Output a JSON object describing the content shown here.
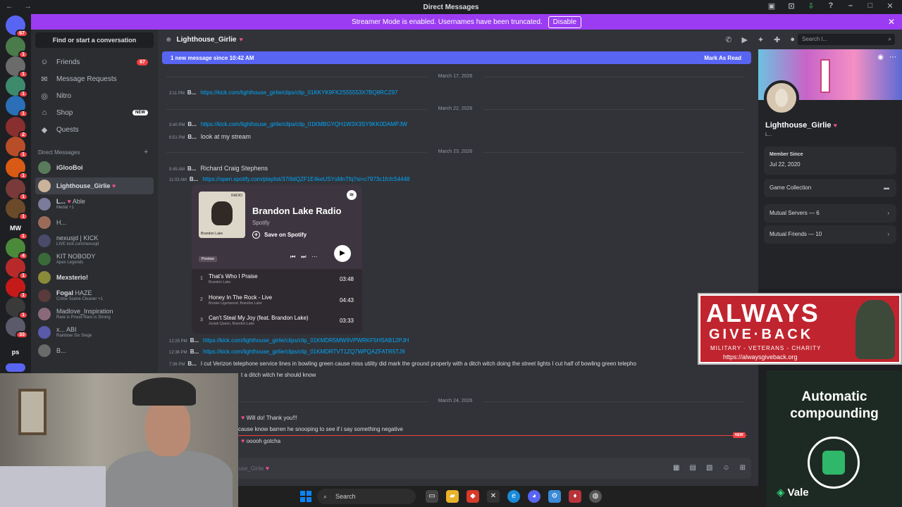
{
  "window": {
    "title": "Direct Messages"
  },
  "banner": {
    "text": "Streamer Mode is enabled. Usernames have been truncated.",
    "button": "Disable"
  },
  "servers": [
    {
      "badge": "67"
    },
    {
      "badge": "1"
    },
    {
      "badge": "1"
    },
    {
      "badge": "1"
    },
    {
      "badge": "1"
    },
    {
      "badge": "2"
    },
    {
      "badge": "1"
    },
    {
      "badge": "1"
    },
    {
      "badge": "1"
    },
    {
      "badge": "1"
    },
    {
      "badge": "1"
    },
    {
      "badge": "4"
    },
    {
      "badge": "1"
    },
    {
      "badge": "1"
    },
    {
      "badge": "1"
    },
    {
      "badge": "1"
    },
    {
      "badge": "33"
    },
    {
      "badge": "2"
    }
  ],
  "server_labels": {
    "mw": "MW",
    "ps": "ps"
  },
  "sidebar": {
    "search": "Find or start a conversation",
    "nav": [
      {
        "label": "Friends",
        "badge": "67"
      },
      {
        "label": "Message Requests"
      },
      {
        "label": "Nitro"
      },
      {
        "label": "Shop",
        "badge": "NEW"
      },
      {
        "label": "Quests"
      }
    ],
    "dm_header": "Direct Messages",
    "dms": [
      {
        "name": "iGlooBoi",
        "sub": ""
      },
      {
        "name": "Lighthouse_Girlie",
        "sub": ""
      },
      {
        "name": "L...",
        "sub": "Medal +1",
        "tag": "Able"
      },
      {
        "name": "H...",
        "sub": ""
      },
      {
        "name": "nexusjd | KICK",
        "sub": "LIVE kick.com/nexusjd"
      },
      {
        "name": "KIT NOBODY",
        "sub": "Apex Legends"
      },
      {
        "name": "Mexsterio!",
        "sub": ""
      },
      {
        "name": "Fogal",
        "sub": "Crime Scene Cleaner +1",
        "tag": "HAZE"
      },
      {
        "name": "Madlove_Inspiration",
        "sub": "Rare is Proud Rare is Strong"
      },
      {
        "name": "x...",
        "sub": "Rainbow Six Siege",
        "tag": "ABI"
      },
      {
        "name": "B...",
        "sub": ""
      }
    ]
  },
  "chat": {
    "channel": "Lighthouse_Girlie",
    "search_placeholder": "Search l...",
    "new_bar": "1 new message since 10:42 AM",
    "mark_read": "Mark As Read",
    "dates": [
      "March 17, 2026",
      "March 22, 2026",
      "March 23, 2026",
      "March 24, 2026"
    ],
    "messages": [
      {
        "time": "3:11 PM",
        "author": "B...",
        "text": "https://kick.com/lighthouse_girlie/clips/clip_01KKYK9FK2S55553X7BQ8RCZ97",
        "link": true
      },
      {
        "time": "3:40 PM",
        "author": "B...",
        "text": "https://kick.com/lighthouse_girlie/clips/clip_01KMBGYQH1W3X3SY9KK0DAMPJW",
        "link": true
      },
      {
        "time": "6:51 PM",
        "author": "B...",
        "text": "look at my stream",
        "link": false
      },
      {
        "time": "9:45 AM",
        "author": "B...",
        "text": "Richard Craig Stephens",
        "link": false
      },
      {
        "time": "11:03 AM",
        "author": "B...",
        "text": "https://open.spotify.com/playlist/37i9dQZF1E4keUSYsMnTfq?si=c7973c1fcfc54448",
        "link": true
      },
      {
        "time": "12:25 PM",
        "author": "B...",
        "text": "https://kick.com/lighthouse_girlie/clips/clip_01KMDR5MW9VPWRKF5HSAB12PJH",
        "link": true
      },
      {
        "time": "12:36 PM",
        "author": "B...",
        "text": "https://kick.com/lighthouse_girlie/clips/clip_01KMDRTVT1ZQ7WPQAZFATR5TJ9",
        "link": true
      },
      {
        "time": "7:36 PM",
        "author": "B...",
        "text": "I cut Verizon telephone service lines in bowling green cause miss utility did mark the ground properly with a ditch witch doing the street lights I cut half of bowling green telepho",
        "link": false
      },
      {
        "time": "",
        "author": "",
        "text": "t a ditch witch he should know",
        "link": false
      },
      {
        "time": "",
        "author": "",
        "text": "Will do! Thank you!!!",
        "link": false
      },
      {
        "time": "",
        "author": "",
        "text": "cause know barren he snooping to see if i say something negative",
        "link": false
      },
      {
        "time": "",
        "author": "",
        "text": "ooooh gotcha",
        "link": false
      }
    ],
    "new_tag": "NEW",
    "input_placeholder": "ouse_Girlie"
  },
  "spotify": {
    "title": "Brandon Lake Radio",
    "source": "Spotify",
    "save": "Save on Spotify",
    "preview": "Preview",
    "art_label": "RADIO",
    "art_artist": "Brandon Lake",
    "tracks": [
      {
        "n": "1",
        "title": "That's Who I Praise",
        "artist": "Brandon Lake",
        "dur": "03:48"
      },
      {
        "n": "2",
        "title": "Honey In The Rock - Live",
        "artist": "Brooke Ligertwood, Brandon Lake",
        "dur": "04:43"
      },
      {
        "n": "3",
        "title": "Can't Steal My Joy (feat. Brandon Lake)",
        "artist": "Josiah Queen, Brandon Lake",
        "dur": "03:33"
      }
    ]
  },
  "profile": {
    "name": "Lighthouse_Girlie",
    "sub": "L...",
    "member_since_label": "Member Since",
    "member_since": "Jul 22, 2020",
    "game_collection": "Game Collection",
    "mutual_servers": "Mutual Servers — 6",
    "mutual_friends": "Mutual Friends — 10"
  },
  "overlay_ad1": {
    "line1": "ALWAYS",
    "line2": "GIVE·BACK",
    "line3": "MILITARY - VETERANS - CHARITY",
    "url": "https://alwaysgiveback.org"
  },
  "overlay_ad2": {
    "text": "Automatic compounding",
    "brand": "Vale"
  },
  "taskbar": {
    "search": "Search"
  },
  "colors": {
    "accent": "#5865f2",
    "streamer": "#9b3cf2",
    "link": "#00a8fc",
    "danger": "#f23f43"
  }
}
